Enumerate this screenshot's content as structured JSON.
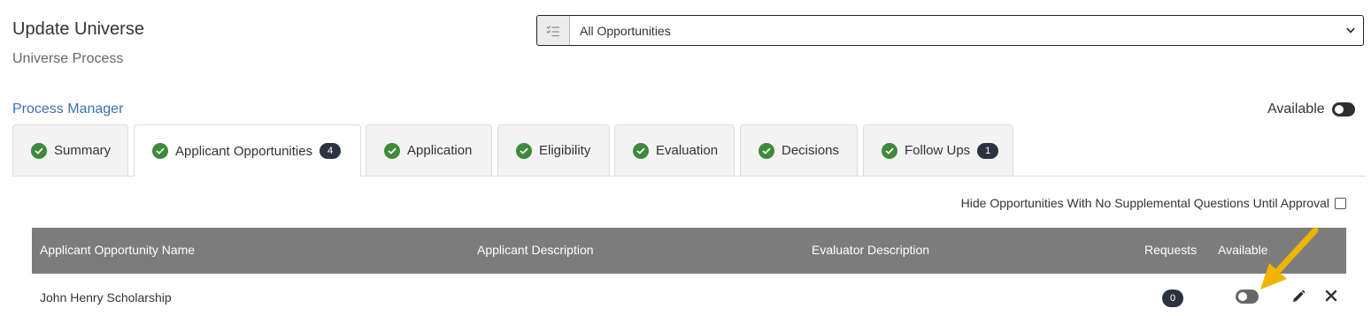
{
  "header": {
    "title": "Update Universe",
    "subtitle": "Universe Process"
  },
  "filter": {
    "icon": "list-check-icon",
    "selected": "All Opportunities"
  },
  "process_manager": {
    "link_label": "Process Manager",
    "available_label": "Available"
  },
  "tabs": [
    {
      "label": "Summary",
      "badge": ""
    },
    {
      "label": "Applicant Opportunities",
      "badge": "4"
    },
    {
      "label": "Application",
      "badge": ""
    },
    {
      "label": "Eligibility",
      "badge": ""
    },
    {
      "label": "Evaluation",
      "badge": ""
    },
    {
      "label": "Decisions",
      "badge": ""
    },
    {
      "label": "Follow Ups",
      "badge": "1"
    }
  ],
  "hide_option": {
    "label": "Hide Opportunities With No Supplemental Questions Until Approval",
    "checked": false
  },
  "table": {
    "columns": [
      "Applicant Opportunity Name",
      "Applicant Description",
      "Evaluator Description",
      "Requests",
      "Available"
    ],
    "rows": [
      {
        "name": "John Henry Scholarship",
        "applicant_description": "",
        "evaluator_description": "",
        "requests": "0",
        "available": false
      }
    ]
  },
  "colors": {
    "accent_link": "#3b6fb6",
    "check_green": "#3d8a3a",
    "badge_dark": "#2a3342",
    "table_header": "#7c7c7c",
    "arrow": "#f0b400"
  }
}
